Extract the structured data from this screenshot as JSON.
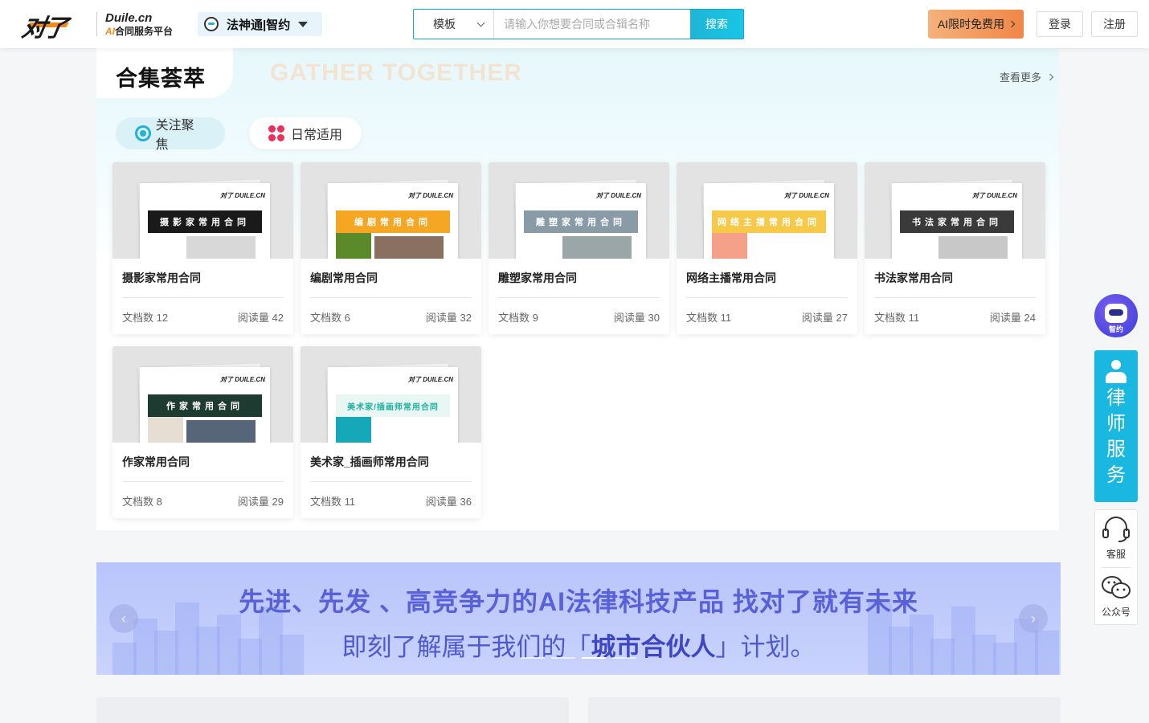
{
  "header": {
    "logo_mark": "对了",
    "logo_domain": "Duile.cn",
    "logo_ai": "AI",
    "logo_tagline": "合同服务平台",
    "product_switch": "法神通|智约",
    "search": {
      "category": "模板",
      "placeholder": "请输入你想要合同或合辑名称",
      "button": "搜索"
    },
    "ai_promo": "AI限时免费用",
    "login": "登录",
    "register": "注册"
  },
  "collection": {
    "title": "合集荟萃",
    "title_en": "GATHER TOGETHER",
    "see_more": "查看更多",
    "tabs": [
      {
        "label": "关注聚焦",
        "icon": "target-icon"
      },
      {
        "label": "日常适用",
        "icon": "flower-icon"
      }
    ],
    "doc_label": "文档数",
    "read_label": "阅读量",
    "cards": [
      {
        "title": "摄影家常用合同",
        "docs": "12",
        "reads": "42",
        "banner": "摄影家常用合同",
        "banner_color": "#1a1a1a"
      },
      {
        "title": "编剧常用合同",
        "docs": "6",
        "reads": "32",
        "banner": "编剧常用合同",
        "banner_color": "#f5a623"
      },
      {
        "title": "雕塑家常用合同",
        "docs": "9",
        "reads": "30",
        "banner": "雕塑家常用合同",
        "banner_color": "#8a9ba8"
      },
      {
        "title": "网络主播常用合同",
        "docs": "11",
        "reads": "27",
        "banner": "网络主播常用合同",
        "banner_color": "#f7c948"
      },
      {
        "title": "书法家常用合同",
        "docs": "11",
        "reads": "24",
        "banner": "书法家常用合同",
        "banner_color": "#3a3a3a"
      },
      {
        "title": "作家常用合同",
        "docs": "8",
        "reads": "29",
        "banner": "作家常用合同",
        "banner_color": "#1d3b30"
      },
      {
        "title": "美术家_插画师常用合同",
        "docs": "11",
        "reads": "36",
        "banner": "美术家/插画师常用合同",
        "banner_color": "#e9f7f4"
      }
    ]
  },
  "promo": {
    "line1": "先进、先发 、高竞争力的AI法律科技产品  找对了就有未来",
    "line2_prefix": "即刻了解属于我们的「",
    "line2_highlight": "城市合伙人",
    "line2_suffix": "」计划。"
  },
  "sidebar": {
    "robot_label": "智约",
    "lawyer_service": [
      "律",
      "师",
      "服",
      "务"
    ],
    "customer_service": "客服",
    "official_account": "公众号"
  }
}
